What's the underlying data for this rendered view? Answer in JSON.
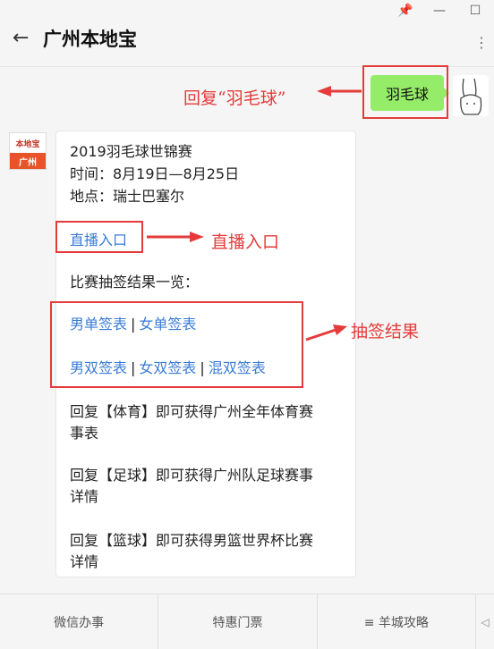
{
  "window": {
    "pin_icon": "📌",
    "minimize_icon": "—",
    "maximize_icon": "☐"
  },
  "header": {
    "back_icon": "←",
    "title": "广州本地宝",
    "more_icon": "⋮"
  },
  "user_message": {
    "text": "羽毛球"
  },
  "bot": {
    "avatar_top": "本地宝",
    "avatar_bottom": "广州"
  },
  "message": {
    "event_title": "2019羽毛球世锦赛",
    "time": "时间：8月19日—8月25日",
    "location": "地点：瑞士巴塞尔",
    "live_link": "直播入口",
    "draw_heading": "比赛抽签结果一览：",
    "draws_row1": [
      "男单签表",
      "女单签表"
    ],
    "draws_row2": [
      "男双签表",
      "女双签表",
      "混双签表"
    ],
    "separator": "|",
    "reply_sports_1": "回复【体育】即可获得广州全年体育赛",
    "reply_sports_2": "事表",
    "reply_football_1": "回复【足球】即可获得广州队足球赛事",
    "reply_football_2": "详情",
    "reply_basketball_1": "回复【篮球】即可获得男篮世界杯比赛",
    "reply_basketball_2": "详情"
  },
  "annotations": {
    "reply": "回复“羽毛球”",
    "live": "直播入口",
    "draw": "抽签结果",
    "color": "#e53b3b"
  },
  "bottom_menu": {
    "item1": "微信办事",
    "item2": "特惠门票",
    "item3": "≡ 羊城攻略",
    "scroll": "◁"
  }
}
